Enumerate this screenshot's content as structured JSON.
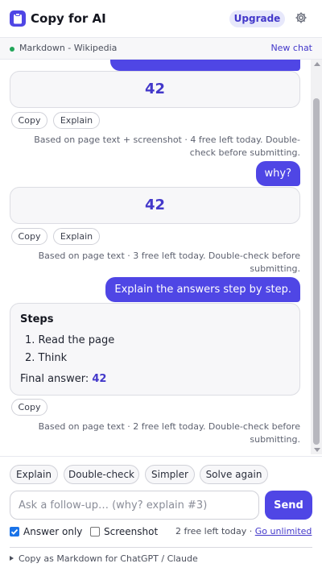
{
  "header": {
    "title": "Copy for AI",
    "upgrade_label": "Upgrade",
    "logo_icon": "clipboard-icon",
    "settings_icon": "gear-icon"
  },
  "page_bar": {
    "page_name": "Markdown - Wikipedia",
    "status_color": "#22a559",
    "new_chat_label": "New chat"
  },
  "chat": {
    "first_answer": {
      "value": "42",
      "copy_label": "Copy",
      "explain_label": "Explain",
      "meta": "Based on page text + screenshot · 4 free left today. Double-check before submitting."
    },
    "user_msg_1": "why?",
    "second_answer": {
      "value": "42",
      "copy_label": "Copy",
      "explain_label": "Explain",
      "meta": "Based on page text · 3 free left today. Double-check before submitting."
    },
    "user_msg_2": "Explain the answers step by step.",
    "steps_answer": {
      "title": "Steps",
      "steps": [
        "1. Read the page",
        "2. Think"
      ],
      "final_label": "Final answer: ",
      "final_value": "42",
      "copy_label": "Copy",
      "meta": "Based on page text · 2 free left today. Double-check before submitting."
    }
  },
  "composer": {
    "chips": [
      "Explain",
      "Double-check",
      "Simpler",
      "Solve again"
    ],
    "placeholder": "Ask a follow-up… (why? explain #3)",
    "send_label": "Send",
    "answer_only_label": "Answer only",
    "answer_only_checked": true,
    "screenshot_label": "Screenshot",
    "screenshot_checked": false,
    "quota_text": "2 free left today · ",
    "unlimited_link": "Go unlimited",
    "export_label": "Copy as Markdown for ChatGPT / Claude"
  },
  "colors": {
    "accent": "#4f46e5",
    "accent_text": "#4338ca",
    "upgrade_bg": "#e7e8fb"
  }
}
